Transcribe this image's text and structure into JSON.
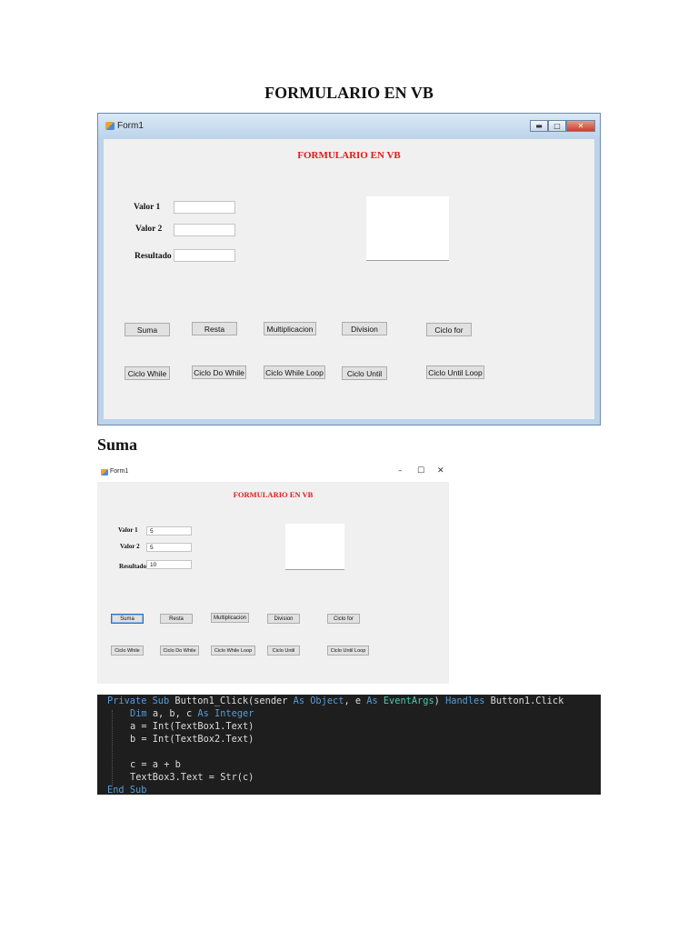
{
  "page_title": "FORMULARIO EN VB",
  "section_heading": "Suma",
  "window1": {
    "title": "Form1",
    "heading": "FORMULARIO EN VB",
    "labels": {
      "valor1": "Valor 1",
      "valor2": "Valor 2",
      "resultado": "Resultado"
    },
    "values": {
      "valor1": "",
      "valor2": "",
      "resultado": ""
    },
    "buttons": {
      "suma": "Suma",
      "resta": "Resta",
      "multiplicacion": "Multiplicacion",
      "division": "Division",
      "ciclo_for": "Ciclo for",
      "ciclo_while": "Ciclo While",
      "ciclo_do_while": "Ciclo Do While",
      "ciclo_while_loop": "Ciclo While Loop",
      "ciclo_until": "Ciclo Until",
      "ciclo_until_loop": "Ciclo Until Loop"
    }
  },
  "window2": {
    "title": "Form1",
    "heading": "FORMULARIO EN VB",
    "labels": {
      "valor1": "Valor 1",
      "valor2": "Valor 2",
      "resultado": "Resultado"
    },
    "values": {
      "valor1": "5",
      "valor2": "5",
      "resultado": "10"
    },
    "controls": {
      "minimize": "–",
      "maximize": "☐",
      "close": "✕"
    },
    "buttons": {
      "suma": "Suma",
      "resta": "Resta",
      "multiplicacion": "Multiplicacion",
      "division": "Division",
      "ciclo_for": "Ciclo for",
      "ciclo_while": "Ciclo While",
      "ciclo_do_while": "Ciclo Do While",
      "ciclo_while_loop": "Ciclo While Loop",
      "ciclo_until": "Ciclo Until",
      "ciclo_until_loop": "Ciclo Until Loop"
    }
  },
  "code": {
    "line1": {
      "private": "Private",
      "sub": "Sub",
      "name": "Button1_Click",
      "open": "(sender",
      "as1": "As",
      "object": "Object",
      "comma": ", e",
      "as2": "As",
      "eventargs": "EventArgs",
      "close": ")",
      "handles": "Handles",
      "target": "Button1.Click"
    },
    "line2": {
      "dim": "Dim",
      "vars": "a, b, c",
      "as": "As",
      "integer": "Integer"
    },
    "line3": "a = Int(TextBox1.Text)",
    "line4": "b = Int(TextBox2.Text)",
    "line6": "c = a + b",
    "line7": "TextBox3.Text = Str(c)",
    "line8": {
      "end": "End",
      "sub": "Sub"
    }
  }
}
